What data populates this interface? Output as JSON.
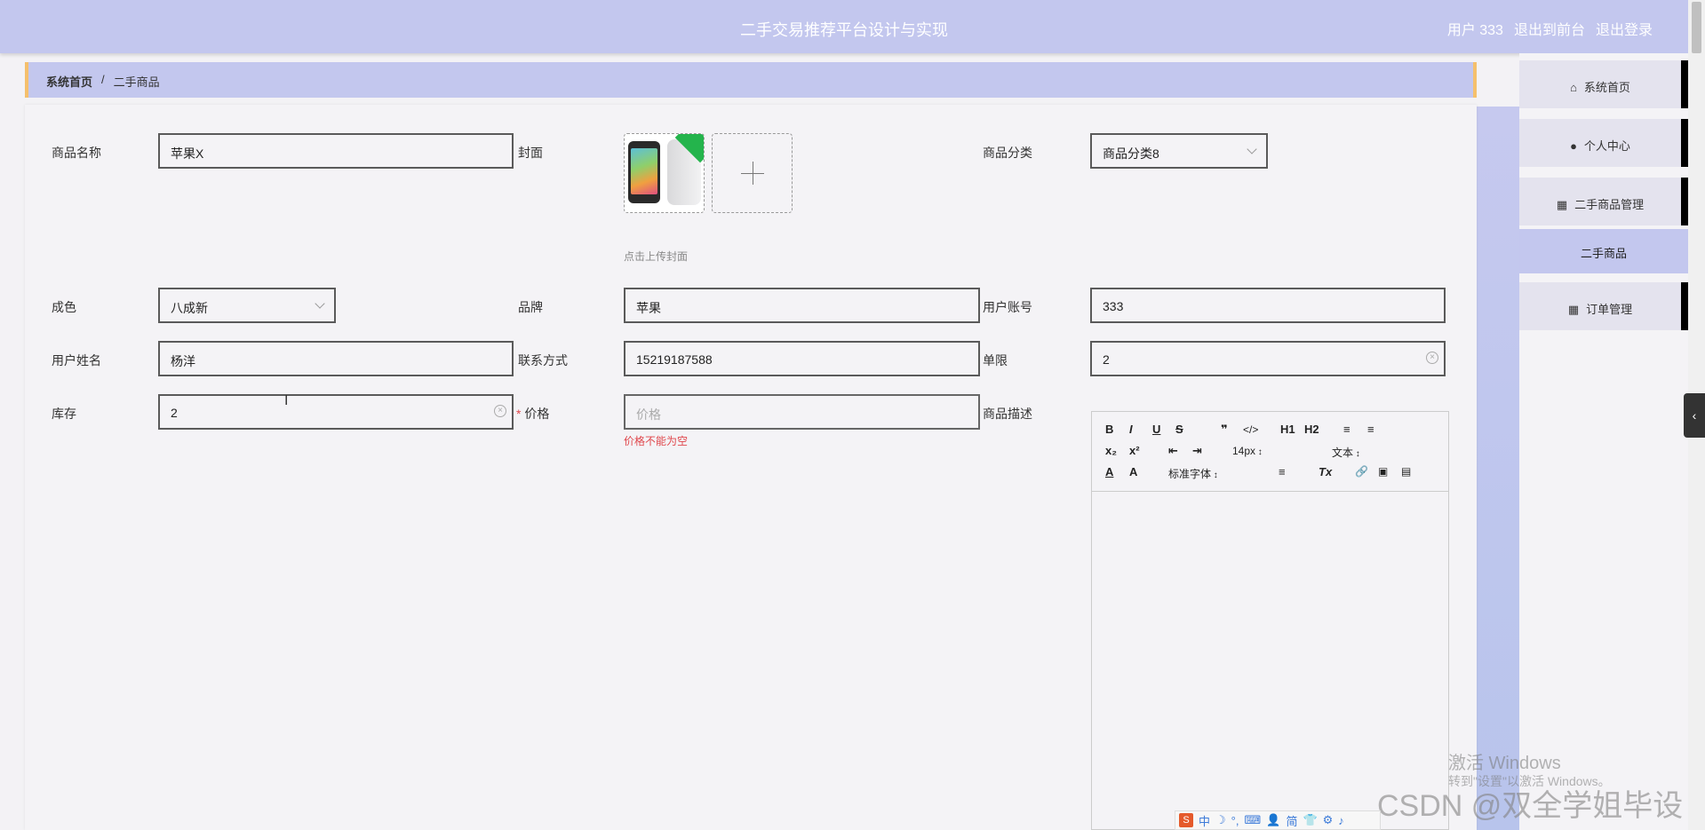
{
  "header": {
    "title": "二手交易推荐平台设计与实现",
    "user_label": "用户 333",
    "to_front": "退出到前台",
    "logout": "退出登录"
  },
  "breadcrumb": {
    "home": "系统首页",
    "separator": "/",
    "current": "二手商品"
  },
  "form": {
    "name_label": "商品名称",
    "name_value": "苹果X",
    "cover_label": "封面",
    "cover_hint": "点击上传封面",
    "category_label": "商品分类",
    "category_value": "商品分类8",
    "condition_label": "成色",
    "condition_value": "八成新",
    "brand_label": "品牌",
    "brand_value": "苹果",
    "account_label": "用户账号",
    "account_value": "333",
    "username_label": "用户姓名",
    "username_value": "杨洋",
    "contact_label": "联系方式",
    "contact_value": "15219187588",
    "limit_label": "单限",
    "limit_value": "2",
    "stock_label": "库存",
    "stock_value": "2",
    "price_required": "*",
    "price_label": "价格",
    "price_placeholder": "价格",
    "price_error": "价格不能为空",
    "desc_label": "商品描述"
  },
  "editor": {
    "buttons": [
      "B",
      "I",
      "U",
      "S",
      "❞",
      "</>",
      "H1",
      "H2",
      "≡",
      "≡",
      "x₂",
      "x²",
      "⇤",
      "⇥",
      "A",
      "A",
      "≡",
      "Tx",
      "🔗",
      "▣",
      "▤"
    ],
    "font_size": "14px",
    "heading": "文本",
    "font_family": "标准字体"
  },
  "sidebar": {
    "items": [
      {
        "label": "系统首页",
        "icon": "home-icon"
      },
      {
        "label": "个人中心",
        "icon": "user-icon"
      },
      {
        "label": "二手商品管理",
        "icon": "grid-icon"
      },
      {
        "label": "订单管理",
        "icon": "grid-icon"
      }
    ],
    "sub_item": "二手商品"
  },
  "overlay": {
    "windows_line1": "激活 Windows",
    "windows_line2": "转到\"设置\"以激活 Windows。",
    "csdn": "CSDN @双全学姐毕设",
    "ime": [
      "中",
      "☽",
      "°,",
      "⌨",
      "👤",
      "简",
      "👕",
      "⚙",
      "♪"
    ]
  }
}
